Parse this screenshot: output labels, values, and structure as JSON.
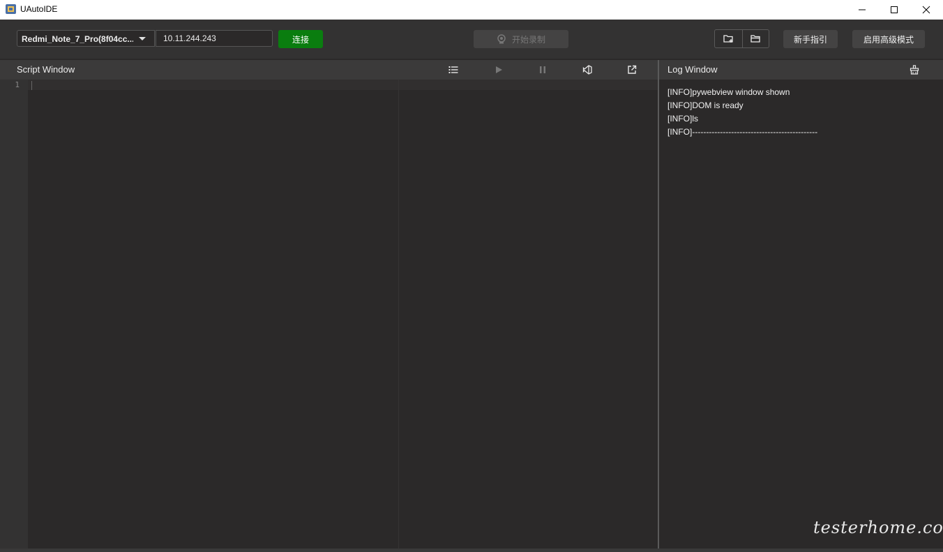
{
  "window": {
    "title": "UAutoIDE",
    "controls": [
      "minimize-icon",
      "maximize-icon",
      "close-icon"
    ]
  },
  "toolbar": {
    "device_selected": "Redmi_Note_7_Pro(8f04cc...",
    "ip_value": "10.11.244.243",
    "connect_label": "连接",
    "record_label": "开始录制",
    "folder_icons": [
      "new-folder-icon",
      "open-folder-icon"
    ],
    "guide_label": "新手指引",
    "advanced_label": "启用高级模式"
  },
  "script_window": {
    "title": "Script Window",
    "toolbar_icons": [
      "list-icon",
      "play-icon",
      "pause-icon",
      "vscode-icon",
      "external-link-icon"
    ],
    "line_numbers": [
      "1"
    ]
  },
  "log_window": {
    "title": "Log Window",
    "header_icon": "clear-log-icon",
    "lines": [
      "[INFO]pywebview window shown",
      "[INFO]DOM is ready",
      "[INFO]ls",
      "[INFO]---------------------------------------------"
    ]
  },
  "watermark": "testerhome.com",
  "colors": {
    "connect_bg": "#0a7d0f",
    "background": "#2b2929",
    "toolbar_bg": "#333232",
    "header_bg": "#3b3a3a"
  }
}
